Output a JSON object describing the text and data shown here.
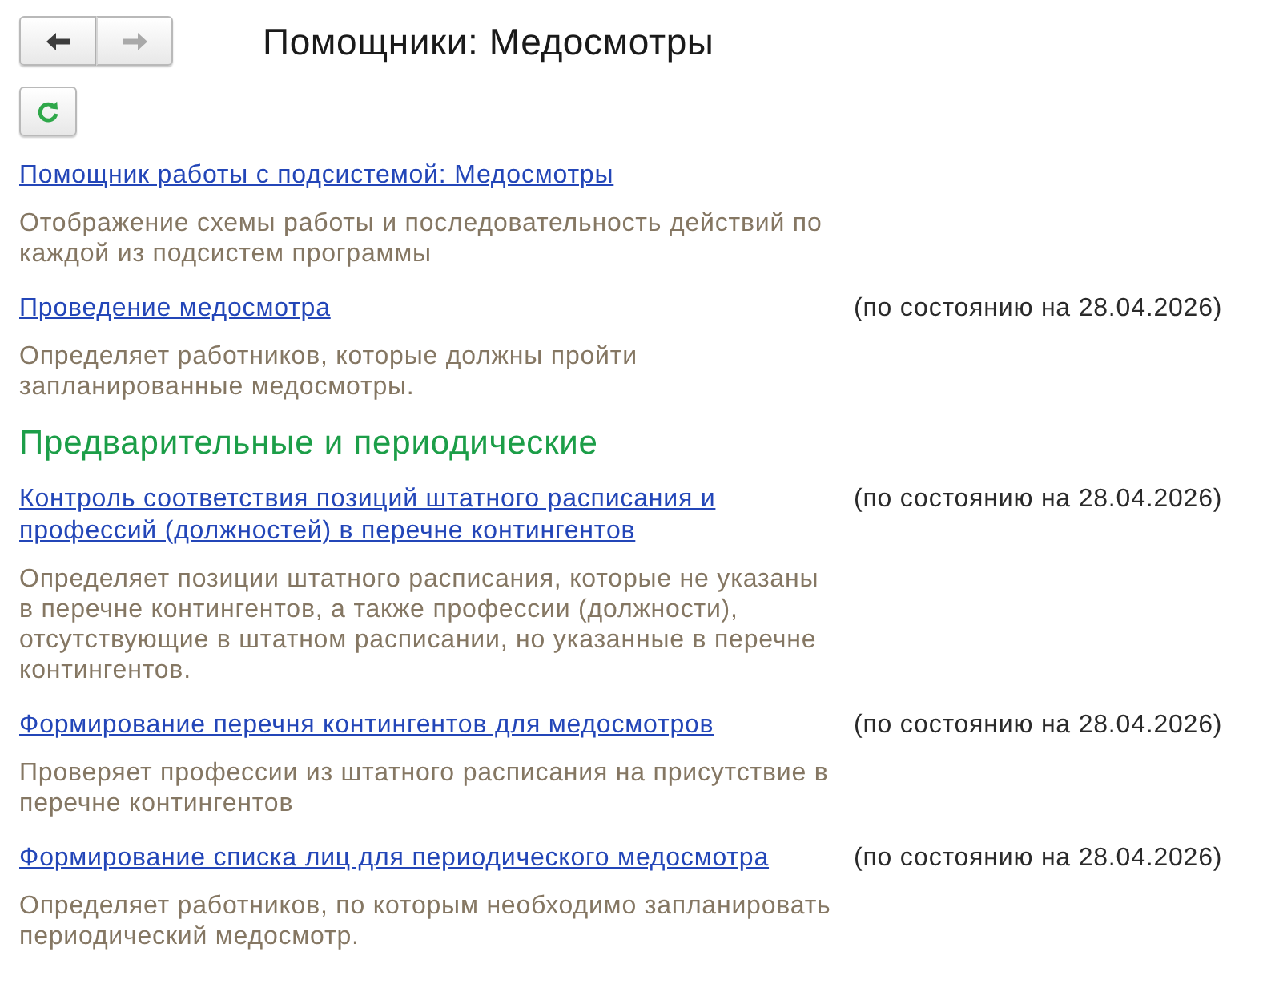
{
  "navigation": {
    "back": {
      "disabled": false
    },
    "forward": {
      "disabled": true
    }
  },
  "title": "Помощники: Медосмотры",
  "groups": [
    {
      "items": [
        {
          "title": "Помощник работы с подсистемой: Медосмотры",
          "description": "Отображение схемы работы и последовательность действий по каждой из подсистем программы"
        },
        {
          "title": "Проведение медосмотра",
          "status": "(по состоянию на 28.04.2026)",
          "description": "Определяет работников, которые должны пройти запланированные медосмотры."
        }
      ]
    },
    {
      "heading": "Предварительные и периодические",
      "items": [
        {
          "title": "Контроль соответствия позиций штатного расписания и профессий (должностей) в перечне контингентов",
          "status": "(по состоянию на 28.04.2026)",
          "description": "Определяет позиции штатного расписания, которые не указаны в перечне контингентов, а также профессии (должности), отсутствующие в штатном расписании, но указанные в перечне контингентов."
        },
        {
          "title": "Формирование перечня контингентов для медосмотров",
          "status": "(по состоянию на 28.04.2026)",
          "description": "Проверяет профессии из штатного расписания на присутствие в перечне контингентов"
        },
        {
          "title": "Формирование списка лиц для периодического медосмотра",
          "status": "(по состоянию на 28.04.2026)",
          "description": "Определяет работников, по которым необходимо запланировать периодический медосмотр."
        }
      ]
    }
  ]
}
